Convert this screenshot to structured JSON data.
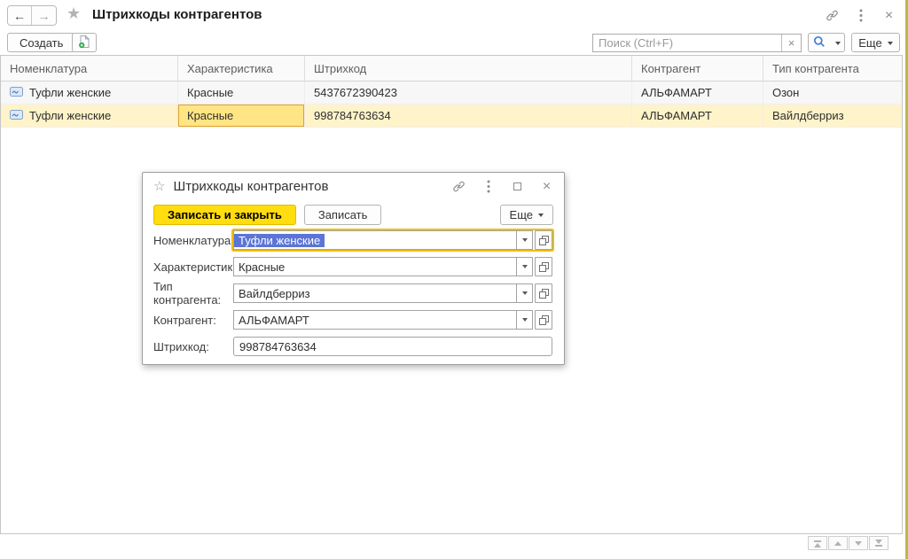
{
  "window": {
    "title": "Штрихкоды контрагентов",
    "toolbar": {
      "create_label": "Создать",
      "search_placeholder": "Поиск (Ctrl+F)",
      "more_label": "Еще"
    },
    "table": {
      "columns": [
        "Номенклатура",
        "Характеристика",
        "Штрихкод",
        "Контрагент",
        "Тип контрагента"
      ],
      "rows": [
        {
          "nomenclature": "Туфли женские",
          "characteristic": "Красные",
          "barcode": "5437672390423",
          "counterparty": "АЛЬФАМАРТ",
          "counterparty_type": "Озон",
          "selected": false
        },
        {
          "nomenclature": "Туфли женские",
          "characteristic": "Красные",
          "barcode": "998784763634",
          "counterparty": "АЛЬФАМАРТ",
          "counterparty_type": "Вайлдберриз",
          "selected": true,
          "active_cell": "characteristic"
        }
      ]
    }
  },
  "dialog": {
    "title": "Штрихкоды контрагентов",
    "buttons": {
      "save_and_close": "Записать и закрыть",
      "save": "Записать",
      "more": "Еще"
    },
    "fields": [
      {
        "label": "Номенклатура:",
        "value": "Туфли женские",
        "control": "combo",
        "focused": true,
        "text_selected": true
      },
      {
        "label": "Характеристика:",
        "value": "Красные",
        "control": "combo",
        "focused": false
      },
      {
        "label": "Тип контрагента:",
        "value": "Вайлдберриз",
        "control": "combo",
        "focused": false
      },
      {
        "label": "Контрагент:",
        "value": "АЛЬФАМАРТ",
        "control": "combo",
        "focused": false
      },
      {
        "label": "Штрихкод:",
        "value": "998784763634",
        "control": "text",
        "focused": false
      }
    ]
  },
  "icons": {
    "back_arrow": "←",
    "forward_arrow": "→",
    "favorite_star": "★",
    "dialog_star": "☆",
    "close": "×",
    "clear_search": "×"
  },
  "colors": {
    "accent_yellow": "#FFDD0E",
    "selected_row_bg": "#FFF3C9",
    "active_cell_bg": "#FFE584",
    "active_cell_border": "#E2A127",
    "text_selection_blue": "#5B74D6",
    "focus_border": "#EFBE0C",
    "search_icon_blue": "#3D7EDB",
    "window_edge_olive": "#B9B94C"
  }
}
